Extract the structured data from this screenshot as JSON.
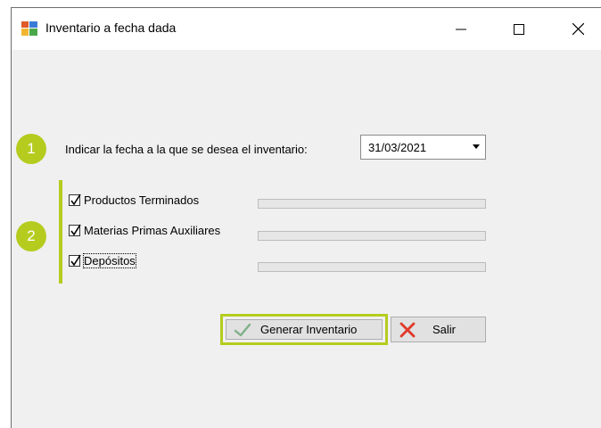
{
  "window": {
    "title": "Inventario a fecha dada",
    "minimize_glyph": "—",
    "maximize_glyph": "☐",
    "close_glyph": "✕"
  },
  "steps": {
    "step1": "1",
    "step2": "2"
  },
  "date": {
    "label": "Indicar la fecha a la que se desea el inventario:",
    "value": "31/03/2021"
  },
  "options": [
    {
      "label": "Productos Terminados",
      "checked": true
    },
    {
      "label": "Materias Primas Auxiliares",
      "checked": true
    },
    {
      "label": "Depósitos",
      "checked": true
    }
  ],
  "buttons": {
    "generar": "Generar Inventario",
    "salir": "Salir"
  },
  "colors": {
    "accent": "#b5cc1f",
    "check_icon": "#7fb08a",
    "cancel_icon": "#e03a2a"
  }
}
